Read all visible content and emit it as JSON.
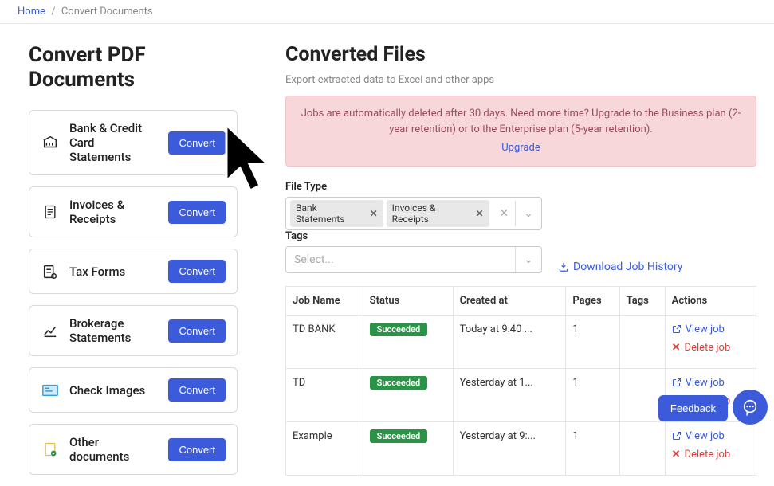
{
  "breadcrumb": {
    "home": "Home",
    "current": "Convert Documents"
  },
  "left": {
    "title": "Convert PDF Documents",
    "button_label": "Convert",
    "items": [
      {
        "label": "Bank & Credit Card Statements"
      },
      {
        "label": "Invoices & Receipts"
      },
      {
        "label": "Tax Forms"
      },
      {
        "label": "Brokerage Statements"
      },
      {
        "label": "Check Images"
      },
      {
        "label": "Other documents"
      }
    ]
  },
  "right": {
    "title": "Converted Files",
    "subtitle": "Export extracted data to Excel and other apps",
    "alert_text": "Jobs are automatically deleted after 30 days. Need more time? Upgrade to the Business plan (2-year retention) or to the Enterprise plan (5-year retention).",
    "alert_link": "Upgrade",
    "file_type_label": "File Type",
    "file_type_chips": [
      "Bank Statements",
      "Invoices & Receipts"
    ],
    "tags_label": "Tags",
    "tags_placeholder": "Select...",
    "download_link": "Download Job History",
    "table": {
      "headers": [
        "Job Name",
        "Status",
        "Created at",
        "Pages",
        "Tags",
        "Actions"
      ],
      "rows": [
        {
          "name": "TD BANK",
          "status": "Succeeded",
          "created": "Today at 9:40 ...",
          "pages": "1",
          "tags": ""
        },
        {
          "name": "TD",
          "status": "Succeeded",
          "created": "Yesterday at 1...",
          "pages": "1",
          "tags": ""
        },
        {
          "name": "Example",
          "status": "Succeeded",
          "created": "Yesterday at 9:...",
          "pages": "1",
          "tags": ""
        }
      ],
      "view_label": "View job",
      "delete_label": "Delete job"
    }
  },
  "feedback_label": "Feedback"
}
